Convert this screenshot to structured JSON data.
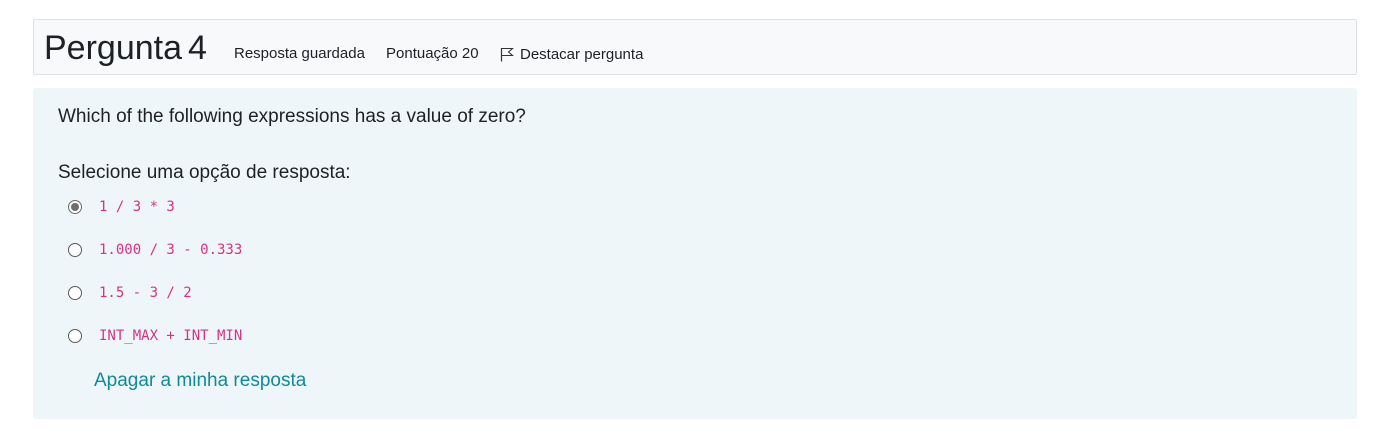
{
  "info": {
    "title_word": "Pergunta",
    "number": "4",
    "state": "Resposta guardada",
    "grade": "Pontuação 20",
    "flag_label": "Destacar pergunta",
    "flag_icon": "flag-icon"
  },
  "question": {
    "text": "Which of the following expressions has a value of zero?",
    "prompt": "Selecione uma opção de resposta:",
    "options": [
      {
        "label": "1 / 3 * 3",
        "selected": true
      },
      {
        "label": "1.000 / 3 - 0.333",
        "selected": false
      },
      {
        "label": "1.5 - 3 / 2",
        "selected": false
      },
      {
        "label": "INT_MAX + INT_MIN",
        "selected": false
      }
    ],
    "clear_label": "Apagar a minha resposta"
  },
  "colors": {
    "code": "#d63384",
    "link": "#0f8a9c",
    "content_bg": "#eef6f9",
    "info_bg": "#f8f9fa"
  }
}
